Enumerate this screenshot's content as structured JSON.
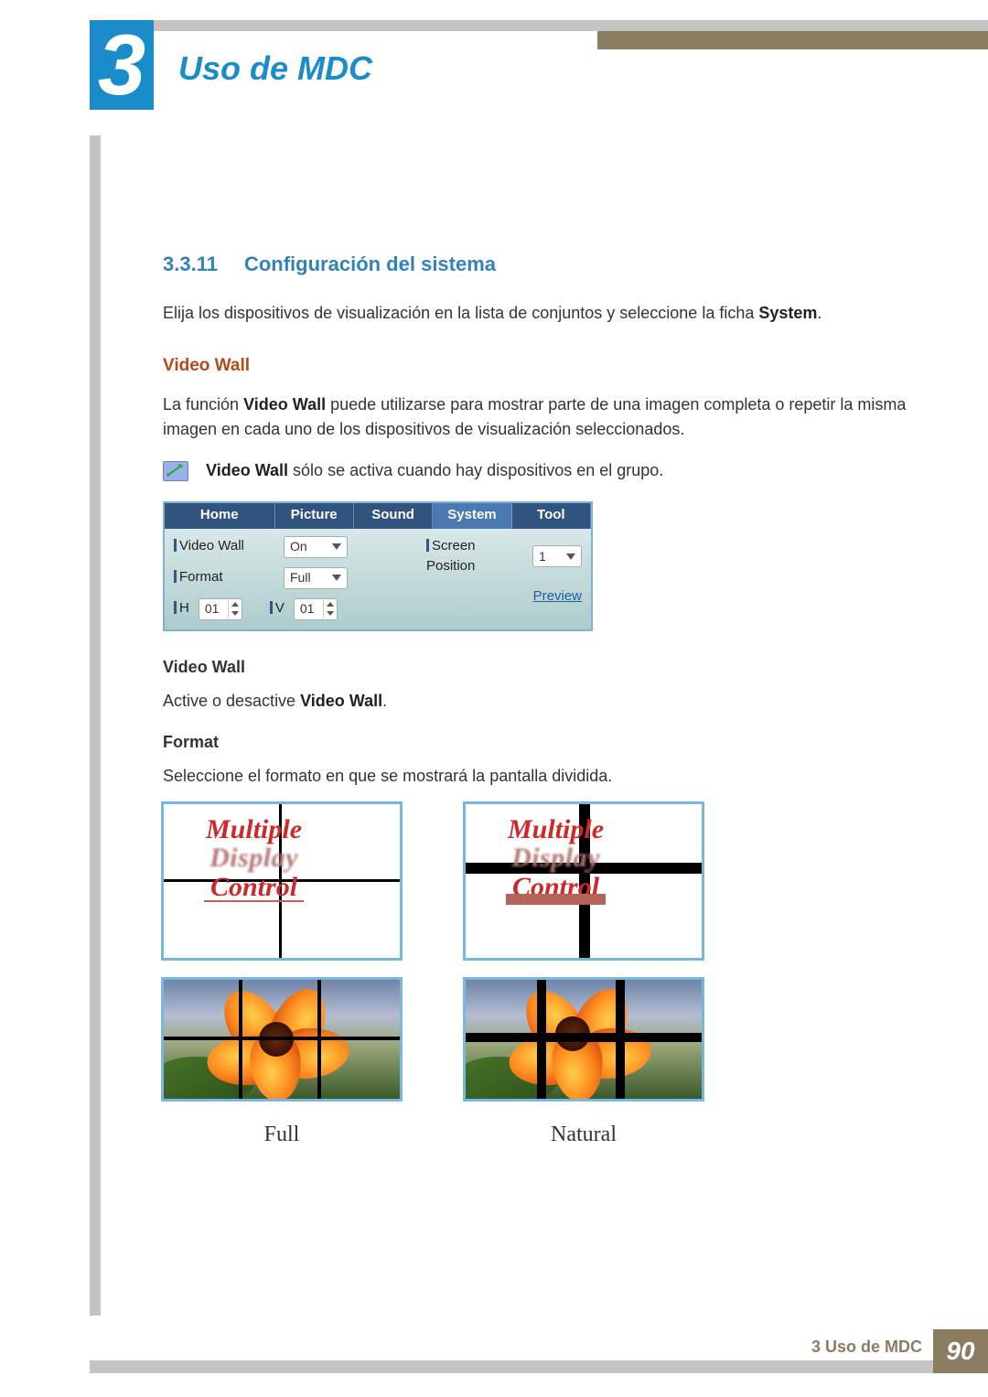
{
  "chapter": {
    "num": "3",
    "title": "Uso de MDC"
  },
  "section": {
    "num": "3.3.11",
    "title": "Configuración del sistema"
  },
  "para1_a": "Elija los dispositivos de visualización en la lista de conjuntos y seleccione la ficha ",
  "para1_b": "System",
  "para1_c": ".",
  "sub1": "Video Wall",
  "para2_a": "La función ",
  "para2_b": "Video Wall",
  "para2_c": " puede utilizarse para mostrar parte de una imagen completa o repetir la misma imagen en cada uno de los dispositivos de visualización seleccionados.",
  "note_b": "Video Wall",
  "note_a": " sólo se activa cuando hay dispositivos en el grupo.",
  "app": {
    "tabs": {
      "home": "Home",
      "picture": "Picture",
      "sound": "Sound",
      "system": "System",
      "tool": "Tool"
    },
    "labels": {
      "videowall": "Video Wall",
      "format": "Format",
      "h": "H",
      "v": "V",
      "screenpos": "Screen Position"
    },
    "values": {
      "videowall": "On",
      "format": "Full",
      "h": "01",
      "v": "01",
      "screenpos": "1"
    },
    "preview": "Preview"
  },
  "opt_vw_head": "Video Wall",
  "opt_vw_a": "Active o desactive ",
  "opt_vw_b": "Video Wall",
  "opt_vw_c": ".",
  "opt_fmt_head": "Format",
  "opt_fmt_text": "Seleccione el formato en que se mostrará la pantalla dividida.",
  "fig_text": {
    "l1": "Multiple",
    "l2": "Display",
    "l3": "Control"
  },
  "fig_labels": {
    "full": "Full",
    "natural": "Natural"
  },
  "footer": {
    "label": "3 Uso de MDC",
    "page": "90"
  }
}
